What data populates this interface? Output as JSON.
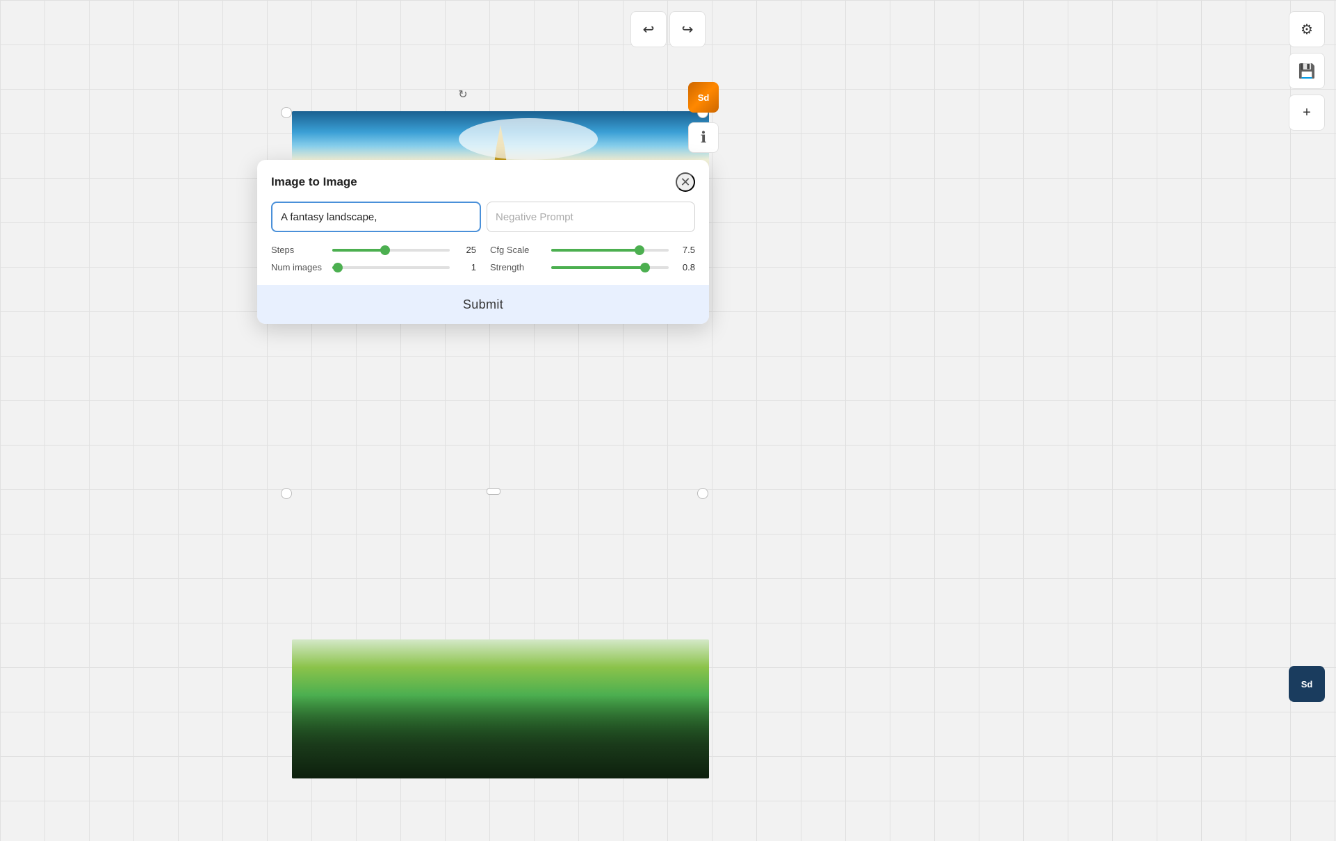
{
  "toolbar": {
    "undo_label": "↩",
    "redo_label": "↪"
  },
  "sidebar": {
    "settings_icon": "⚙",
    "save_icon": "💾",
    "add_icon": "+",
    "sd_badge": "Sd"
  },
  "canvas": {
    "refresh_icon": "↻",
    "sd_logo": "Sd",
    "info_icon": "ℹ"
  },
  "dialog": {
    "title": "Image to Image",
    "close_icon": "✕",
    "prompt_value": "A fantasy landscape,",
    "negative_prompt_placeholder": "Negative Prompt",
    "steps_label": "Steps",
    "steps_value": "25",
    "steps_percent": 45,
    "cfg_scale_label": "Cfg Scale",
    "cfg_scale_value": "7.5",
    "cfg_scale_percent": 75,
    "num_images_label": "Num images",
    "num_images_value": "1",
    "num_images_percent": 5,
    "strength_label": "Strength",
    "strength_value": "0.8",
    "strength_percent": 80,
    "submit_label": "Submit"
  }
}
